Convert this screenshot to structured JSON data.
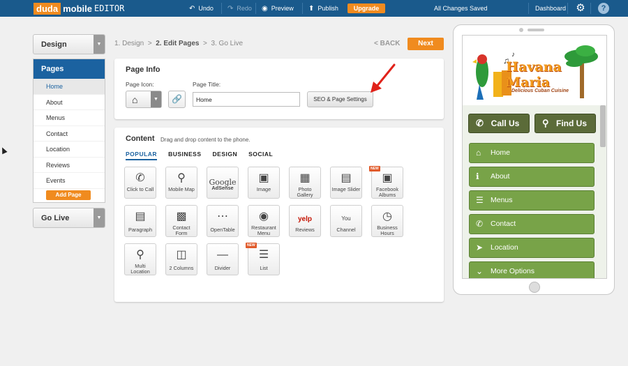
{
  "topbar": {
    "logo_duda": "duda",
    "logo_mobile": "mobile",
    "logo_editor": "EDITOR",
    "undo": "Undo",
    "redo": "Redo",
    "preview": "Preview",
    "publish": "Publish",
    "upgrade": "Upgrade",
    "status": "All Changes Saved",
    "dashboard": "Dashboard",
    "help": "?"
  },
  "sidebar": {
    "design": "Design",
    "pages_title": "Pages",
    "pages": [
      "Home",
      "About",
      "Menus",
      "Contact",
      "Location",
      "Reviews",
      "Events"
    ],
    "add_page": "Add Page",
    "go_live": "Go Live"
  },
  "breadcrumb": {
    "step1": "1. Design",
    "sep1": ">",
    "step2": "2. Edit Pages",
    "sep2": ">",
    "step3": "3. Go Live",
    "back": "< BACK",
    "next": "Next"
  },
  "page_info": {
    "title": "Page Info",
    "icon_label": "Page Icon:",
    "title_label": "Page Title:",
    "title_value": "Home",
    "seo_button": "SEO & Page Settings"
  },
  "content": {
    "title": "Content",
    "subtitle": "Drag and drop content to the phone.",
    "tabs": [
      "POPULAR",
      "BUSINESS",
      "DESIGN",
      "SOCIAL"
    ],
    "tiles_row1": [
      "Click to Call",
      "Mobile Map",
      "AdSense",
      "Image",
      "Photo Gallery",
      "Image Slider",
      "Facebook Albums"
    ],
    "tiles_row2": [
      "Paragraph",
      "Contact Form",
      "OpenTable",
      "Restaurant Menu",
      "Reviews",
      "Channel",
      "Business Hours"
    ],
    "tiles_row3": [
      "Multi Location",
      "2 Columns",
      "Divider",
      "List"
    ],
    "google_word": "Google",
    "yelp_word": "yelp",
    "youtube_word": "You",
    "new_badge": "NEW"
  },
  "phone": {
    "brand_name": "Havana Maria",
    "brand_tagline": "Delicious Cuban Cuisine",
    "call_us": "Call Us",
    "find_us": "Find Us",
    "menu": [
      "Home",
      "About",
      "Menus",
      "Contact",
      "Location",
      "More Options"
    ]
  }
}
